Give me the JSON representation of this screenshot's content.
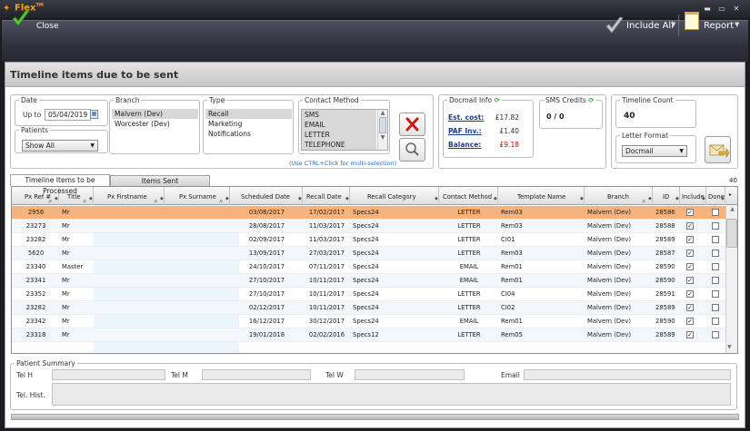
{
  "window": {
    "app_title": "Flex",
    "app_title_tm": "TM"
  },
  "toolbar": {
    "close_label": "Close",
    "include_label": "Include All",
    "report_label": "Report"
  },
  "page": {
    "title": "Timeline items due to be sent"
  },
  "date": {
    "legend": "Date",
    "up_to_label": "Up to",
    "up_to_value": "05/04/2019"
  },
  "patients": {
    "legend": "Patients",
    "selected": "Show All"
  },
  "branch": {
    "legend": "Branch",
    "items": [
      "Malvern (Dev)",
      "Worcester (Dev)"
    ]
  },
  "type": {
    "legend": "Type",
    "items": [
      "Recall",
      "Marketing",
      "Notifications"
    ]
  },
  "contact_method": {
    "legend": "Contact Method",
    "items": [
      "SMS",
      "EMAIL",
      "LETTER",
      "TELEPHONE"
    ],
    "hint": "(Use CTRL+Click for multi-selection)"
  },
  "docmail": {
    "legend": "Docmail Info",
    "est_cost_label": "Est. cost:",
    "est_cost_value": "£17.82",
    "paf_label": "PAF Inv.:",
    "paf_value": "£1.40",
    "balance_label": "Balance:",
    "balance_value": "£9.18",
    "balance_color": "#cc0000"
  },
  "sms": {
    "legend": "SMS Credits",
    "value": "0 / 0"
  },
  "timeline_count": {
    "legend": "Timeline Count",
    "value": "40"
  },
  "letter_format": {
    "legend": "Letter Format",
    "selected": "Docmail"
  },
  "tabs": {
    "processed": "Timeline Items to be Processed",
    "sent": "Items Sent",
    "count": "40"
  },
  "grid": {
    "columns": [
      "Px Ref #",
      "Title",
      "Px Firstname",
      "Px Surname",
      "Scheduled Date",
      "Recall Date",
      "Recall Category",
      "Contact Method",
      "Template Name",
      "Branch",
      "ID",
      "Include",
      "Done"
    ],
    "rows": [
      [
        "2956",
        "Mr",
        "",
        "",
        "03/08/2017",
        "17/02/2017",
        "Specs24",
        "LETTER",
        "Rem03",
        "Malvern (Dev)",
        "28586"
      ],
      [
        "23273",
        "Mr",
        "",
        "",
        "28/08/2017",
        "11/03/2017",
        "Specs24",
        "LETTER",
        "Rem03",
        "Malvern (Dev)",
        "28588"
      ],
      [
        "23282",
        "Mr",
        "",
        "",
        "02/09/2017",
        "11/03/2017",
        "Specs24",
        "LETTER",
        "CI01",
        "Malvern (Dev)",
        "28589"
      ],
      [
        "5620",
        "Mr",
        "",
        "",
        "13/09/2017",
        "27/03/2017",
        "Specs24",
        "LETTER",
        "Rem03",
        "Malvern (Dev)",
        "28587"
      ],
      [
        "23340",
        "Master",
        "",
        "",
        "24/10/2017",
        "07/11/2017",
        "Specs24",
        "EMAIL",
        "Rem01",
        "Malvern (Dev)",
        "28590"
      ],
      [
        "23341",
        "Mr",
        "",
        "",
        "27/10/2017",
        "10/11/2017",
        "Specs24",
        "EMAIL",
        "Rem01",
        "Malvern (Dev)",
        "28590"
      ],
      [
        "23352",
        "Mr",
        "",
        "",
        "27/10/2017",
        "10/11/2017",
        "Specs24",
        "LETTER",
        "CI04",
        "Malvern (Dev)",
        "28591"
      ],
      [
        "23282",
        "Mr",
        "",
        "",
        "02/12/2017",
        "10/11/2017",
        "Specs24",
        "LETTER",
        "CI02",
        "Malvern (Dev)",
        "28589"
      ],
      [
        "23342",
        "Mr",
        "",
        "",
        "16/12/2017",
        "30/12/2017",
        "Specs24",
        "EMAIL",
        "Rem01",
        "Malvern (Dev)",
        "28590"
      ],
      [
        "23318",
        "Mr",
        "",
        "",
        "19/01/2018",
        "02/02/2016",
        "Specs12",
        "LETTER",
        "Rem05",
        "Malvern (Dev)",
        "28589"
      ]
    ]
  },
  "patient_summary": {
    "legend": "Patient Summary",
    "tel_h": "Tel H",
    "tel_m": "Tel M",
    "tel_w": "Tel W",
    "email": "Email",
    "tel_hist": "Tel. Hist."
  },
  "colors": {
    "selected_row": "#f8b27c",
    "accent_orange": "#f0a020",
    "link_blue": "#1a3d8f"
  }
}
